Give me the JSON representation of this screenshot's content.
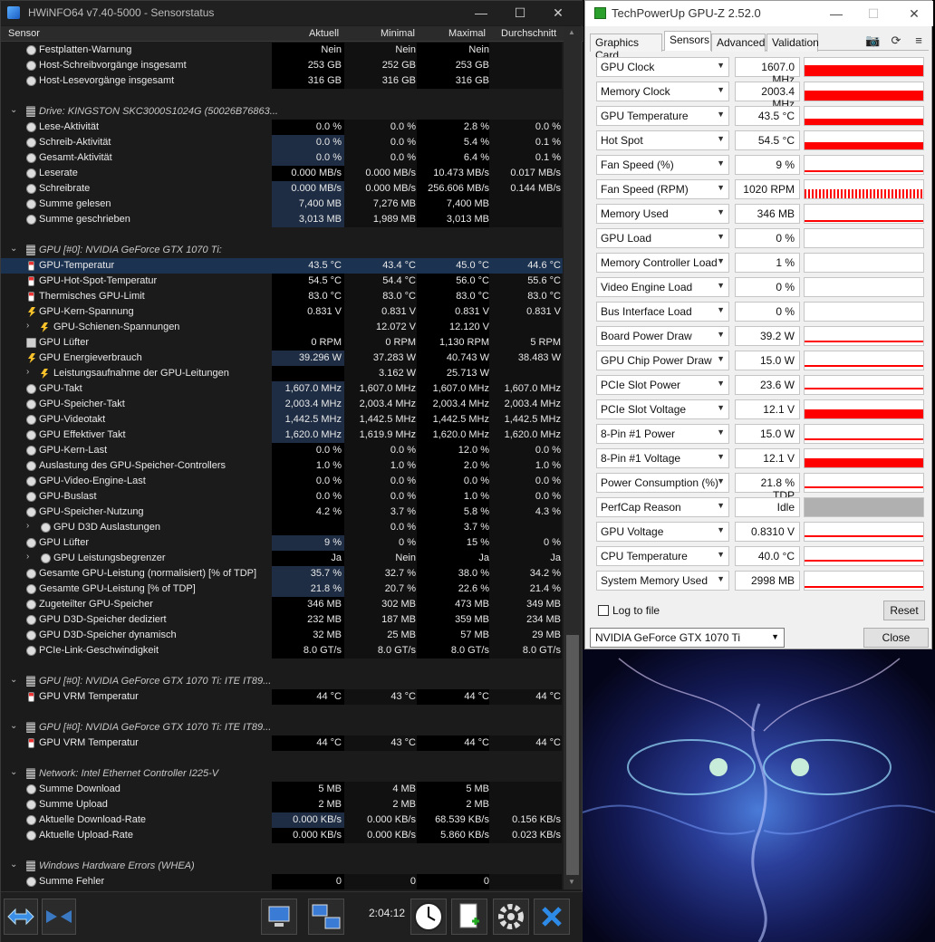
{
  "hwinfo": {
    "title": "HWiNFO64 v7.40-5000 - Sensorstatus",
    "columns": [
      "Sensor",
      "Aktuell",
      "Minimal",
      "Maximal",
      "Durchschnitt"
    ],
    "rows": [
      {
        "name": "Festplatten-Warnung",
        "icon": "circle",
        "v": [
          "Nein",
          "Nein",
          "Nein",
          ""
        ]
      },
      {
        "name": "Host-Schreibvorgänge insgesamt",
        "icon": "circle",
        "v": [
          "253 GB",
          "252 GB",
          "253 GB",
          ""
        ]
      },
      {
        "name": "Host-Lesevorgänge insgesamt",
        "icon": "circle",
        "v": [
          "316 GB",
          "316 GB",
          "316 GB",
          ""
        ]
      },
      {
        "blank": true
      },
      {
        "group": true,
        "name": "Drive: KINGSTON SKC3000S1024G (50026B76863...",
        "icon": "drive"
      },
      {
        "name": "Lese-Aktivität",
        "icon": "circle",
        "v": [
          "0.0 %",
          "0.0 %",
          "2.8 %",
          "0.0 %"
        ]
      },
      {
        "name": "Schreib-Aktivität",
        "icon": "circle",
        "hl": true,
        "v": [
          "0.0 %",
          "0.0 %",
          "5.4 %",
          "0.1 %"
        ]
      },
      {
        "name": "Gesamt-Aktivität",
        "icon": "circle",
        "hl": true,
        "v": [
          "0.0 %",
          "0.0 %",
          "6.4 %",
          "0.1 %"
        ]
      },
      {
        "name": "Leserate",
        "icon": "circle",
        "v": [
          "0.000 MB/s",
          "0.000 MB/s",
          "10.473 MB/s",
          "0.017 MB/s"
        ]
      },
      {
        "name": "Schreibrate",
        "icon": "circle",
        "hl": true,
        "v": [
          "0.000 MB/s",
          "0.000 MB/s",
          "256.606 MB/s",
          "0.144 MB/s"
        ]
      },
      {
        "name": "Summe gelesen",
        "icon": "circle",
        "hl": true,
        "v": [
          "7,400 MB",
          "7,276 MB",
          "7,400 MB",
          ""
        ]
      },
      {
        "name": "Summe geschrieben",
        "icon": "circle",
        "hl": true,
        "v": [
          "3,013 MB",
          "1,989 MB",
          "3,013 MB",
          ""
        ]
      },
      {
        "blank": true
      },
      {
        "group": true,
        "name": "GPU [#0]: NVIDIA GeForce GTX 1070 Ti:",
        "icon": "drive"
      },
      {
        "name": "GPU-Temperatur",
        "icon": "therm",
        "sel": true,
        "v": [
          "43.5 °C",
          "43.4 °C",
          "45.0 °C",
          "44.6 °C"
        ]
      },
      {
        "name": "GPU-Hot-Spot-Temperatur",
        "icon": "therm",
        "v": [
          "54.5 °C",
          "54.4 °C",
          "56.0 °C",
          "55.6 °C"
        ]
      },
      {
        "name": "Thermisches GPU-Limit",
        "icon": "therm",
        "v": [
          "83.0 °C",
          "83.0 °C",
          "83.0 °C",
          "83.0 °C"
        ]
      },
      {
        "name": "GPU-Kern-Spannung",
        "icon": "bolt",
        "v": [
          "0.831 V",
          "0.831 V",
          "0.831 V",
          "0.831 V"
        ]
      },
      {
        "name": "GPU-Schienen-Spannungen",
        "icon": "bolt",
        "sub": true,
        "v": [
          "",
          "12.072 V",
          "12.120 V",
          ""
        ]
      },
      {
        "name": "GPU Lüfter",
        "icon": "fan",
        "v": [
          "0 RPM",
          "0 RPM",
          "1,130 RPM",
          "5 RPM"
        ]
      },
      {
        "name": "GPU Energieverbrauch",
        "icon": "bolt",
        "hl": true,
        "v": [
          "39.296 W",
          "37.283 W",
          "40.743 W",
          "38.483 W"
        ]
      },
      {
        "name": "Leistungsaufnahme der GPU-Leitungen",
        "icon": "bolt",
        "sub": true,
        "v": [
          "",
          "3.162 W",
          "25.713 W",
          ""
        ]
      },
      {
        "name": "GPU-Takt",
        "icon": "circle",
        "hl": true,
        "v": [
          "1,607.0 MHz",
          "1,607.0 MHz",
          "1,607.0 MHz",
          "1,607.0 MHz"
        ]
      },
      {
        "name": "GPU-Speicher-Takt",
        "icon": "circle",
        "hl": true,
        "v": [
          "2,003.4 MHz",
          "2,003.4 MHz",
          "2,003.4 MHz",
          "2,003.4 MHz"
        ]
      },
      {
        "name": "GPU-Videotakt",
        "icon": "circle",
        "hl": true,
        "v": [
          "1,442.5 MHz",
          "1,442.5 MHz",
          "1,442.5 MHz",
          "1,442.5 MHz"
        ]
      },
      {
        "name": "GPU Effektiver Takt",
        "icon": "circle",
        "hl": true,
        "v": [
          "1,620.0 MHz",
          "1,619.9 MHz",
          "1,620.0 MHz",
          "1,620.0 MHz"
        ]
      },
      {
        "name": "GPU-Kern-Last",
        "icon": "circle",
        "v": [
          "0.0 %",
          "0.0 %",
          "12.0 %",
          "0.0 %"
        ]
      },
      {
        "name": "Auslastung des GPU-Speicher-Controllers",
        "icon": "circle",
        "v": [
          "1.0 %",
          "1.0 %",
          "2.0 %",
          "1.0 %"
        ]
      },
      {
        "name": "GPU-Video-Engine-Last",
        "icon": "circle",
        "v": [
          "0.0 %",
          "0.0 %",
          "0.0 %",
          "0.0 %"
        ]
      },
      {
        "name": "GPU-Buslast",
        "icon": "circle",
        "v": [
          "0.0 %",
          "0.0 %",
          "1.0 %",
          "0.0 %"
        ]
      },
      {
        "name": "GPU-Speicher-Nutzung",
        "icon": "circle",
        "v": [
          "4.2 %",
          "3.7 %",
          "5.8 %",
          "4.3 %"
        ]
      },
      {
        "name": "GPU D3D Auslastungen",
        "icon": "circle",
        "sub": true,
        "v": [
          "",
          "0.0 %",
          "3.7 %",
          ""
        ]
      },
      {
        "name": "GPU Lüfter",
        "icon": "circle",
        "hl": true,
        "v": [
          "9 %",
          "0 %",
          "15 %",
          "0 %"
        ]
      },
      {
        "name": "GPU Leistungsbegrenzer",
        "icon": "circle",
        "sub": true,
        "v": [
          "Ja",
          "Nein",
          "Ja",
          "Ja"
        ]
      },
      {
        "name": "Gesamte GPU-Leistung (normalisiert) [% of TDP]",
        "icon": "circle",
        "hl": true,
        "v": [
          "35.7 %",
          "32.7 %",
          "38.0 %",
          "34.2 %"
        ]
      },
      {
        "name": "Gesamte GPU-Leistung [% of TDP]",
        "icon": "circle",
        "hl": true,
        "v": [
          "21.8 %",
          "20.7 %",
          "22.6 %",
          "21.4 %"
        ]
      },
      {
        "name": "Zugeteilter GPU-Speicher",
        "icon": "circle",
        "v": [
          "346 MB",
          "302 MB",
          "473 MB",
          "349 MB"
        ]
      },
      {
        "name": "GPU D3D-Speicher dediziert",
        "icon": "circle",
        "v": [
          "232 MB",
          "187 MB",
          "359 MB",
          "234 MB"
        ]
      },
      {
        "name": "GPU D3D-Speicher dynamisch",
        "icon": "circle",
        "v": [
          "32 MB",
          "25 MB",
          "57 MB",
          "29 MB"
        ]
      },
      {
        "name": "PCIe-Link-Geschwindigkeit",
        "icon": "circle",
        "v": [
          "8.0 GT/s",
          "8.0 GT/s",
          "8.0 GT/s",
          "8.0 GT/s"
        ]
      },
      {
        "blank": true
      },
      {
        "group": true,
        "name": "GPU [#0]: NVIDIA GeForce GTX 1070 Ti: ITE IT89...",
        "icon": "drive"
      },
      {
        "name": "GPU VRM Temperatur",
        "icon": "therm",
        "v": [
          "44 °C",
          "43 °C",
          "44 °C",
          "44 °C"
        ]
      },
      {
        "blank": true
      },
      {
        "group": true,
        "name": "GPU [#0]: NVIDIA GeForce GTX 1070 Ti: ITE IT89...",
        "icon": "drive"
      },
      {
        "name": "GPU VRM Temperatur",
        "icon": "therm",
        "v": [
          "44 °C",
          "43 °C",
          "44 °C",
          "44 °C"
        ]
      },
      {
        "blank": true
      },
      {
        "group": true,
        "name": "Network: Intel Ethernet Controller I225-V",
        "icon": "drive"
      },
      {
        "name": "Summe Download",
        "icon": "circle",
        "v": [
          "5 MB",
          "4 MB",
          "5 MB",
          ""
        ]
      },
      {
        "name": "Summe Upload",
        "icon": "circle",
        "v": [
          "2 MB",
          "2 MB",
          "2 MB",
          ""
        ]
      },
      {
        "name": "Aktuelle Download-Rate",
        "icon": "circle",
        "hl": true,
        "v": [
          "0.000 KB/s",
          "0.000 KB/s",
          "68.539 KB/s",
          "0.156 KB/s"
        ]
      },
      {
        "name": "Aktuelle Upload-Rate",
        "icon": "circle",
        "v": [
          "0.000 KB/s",
          "0.000 KB/s",
          "5.860 KB/s",
          "0.023 KB/s"
        ]
      },
      {
        "blank": true
      },
      {
        "group": true,
        "name": "Windows Hardware Errors (WHEA)",
        "icon": "drive"
      },
      {
        "name": "Summe Fehler",
        "icon": "circle",
        "v": [
          "0",
          "0",
          "0",
          ""
        ]
      }
    ],
    "clock": "2:04:12"
  },
  "gpuz": {
    "title": "TechPowerUp GPU-Z 2.52.0",
    "tabs": [
      "Graphics Card",
      "Sensors",
      "Advanced",
      "Validation"
    ],
    "active_tab": "Sensors",
    "sensors": [
      {
        "label": "GPU Clock",
        "value": "1607.0 MHz",
        "level": 0.55,
        "style": "solid"
      },
      {
        "label": "Memory Clock",
        "value": "2003.4 MHz",
        "level": 0.5,
        "style": "solid"
      },
      {
        "label": "GPU Temperature",
        "value": "43.5 °C",
        "level": 0.3,
        "style": "solid"
      },
      {
        "label": "Hot Spot",
        "value": "54.5 °C",
        "level": 0.35,
        "style": "solid"
      },
      {
        "label": "Fan Speed (%)",
        "value": "9 %",
        "level": 0.1,
        "style": "thin"
      },
      {
        "label": "Fan Speed (RPM)",
        "value": "1020 RPM",
        "level": 0.45,
        "style": "stripe"
      },
      {
        "label": "Memory Used",
        "value": "346 MB",
        "level": 0.08,
        "style": "thin"
      },
      {
        "label": "GPU Load",
        "value": "0 %",
        "level": 0,
        "style": "none"
      },
      {
        "label": "Memory Controller Load",
        "value": "1 %",
        "level": 0,
        "style": "none"
      },
      {
        "label": "Video Engine Load",
        "value": "0 %",
        "level": 0,
        "style": "none"
      },
      {
        "label": "Bus Interface Load",
        "value": "0 %",
        "level": 0,
        "style": "none"
      },
      {
        "label": "Board Power Draw",
        "value": "39.2 W",
        "level": 0.18,
        "style": "thin"
      },
      {
        "label": "GPU Chip Power Draw",
        "value": "15.0 W",
        "level": 0.18,
        "style": "thin"
      },
      {
        "label": "PCIe Slot Power",
        "value": "23.6 W",
        "level": 0.3,
        "style": "thin"
      },
      {
        "label": "PCIe Slot Voltage",
        "value": "12.1 V",
        "level": 0.45,
        "style": "solid"
      },
      {
        "label": "8-Pin #1 Power",
        "value": "15.0 W",
        "level": 0.15,
        "style": "thin"
      },
      {
        "label": "8-Pin #1 Voltage",
        "value": "12.1 V",
        "level": 0.45,
        "style": "solid"
      },
      {
        "label": "Power Consumption (%)",
        "value": "21.8 % TDP",
        "level": 0.2,
        "style": "thin"
      },
      {
        "label": "PerfCap Reason",
        "value": "Idle",
        "level": 1,
        "style": "gray"
      },
      {
        "label": "GPU Voltage",
        "value": "0.8310 V",
        "level": 0.2,
        "style": "thin"
      },
      {
        "label": "CPU Temperature",
        "value": "40.0 °C",
        "level": 0.2,
        "style": "thin"
      },
      {
        "label": "System Memory Used",
        "value": "2998 MB",
        "level": 0.12,
        "style": "thin"
      }
    ],
    "log_label": "Log to file",
    "reset_label": "Reset",
    "gpu_select": "NVIDIA GeForce GTX 1070 Ti",
    "close_label": "Close"
  },
  "colors": {
    "graph": "#ff0000",
    "perfcap": "#b0b0b0",
    "highlight": "#1e2d44",
    "selected": "#1b3250"
  }
}
